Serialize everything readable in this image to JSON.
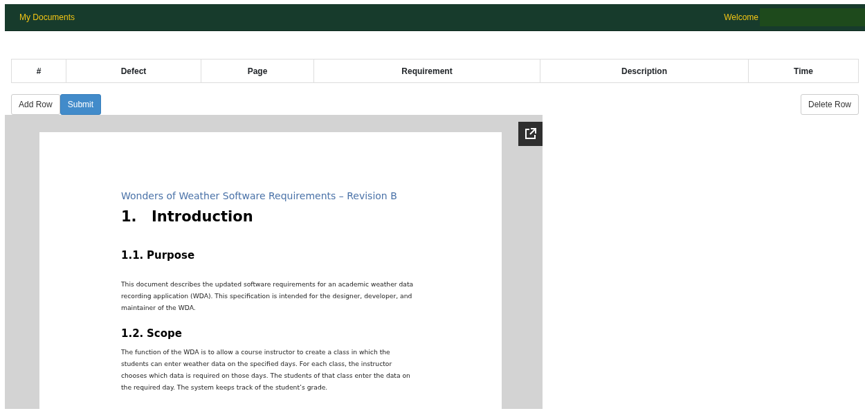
{
  "navbar": {
    "brand": "My Documents",
    "welcome": "Welcome"
  },
  "table": {
    "columns": [
      "#",
      "Defect",
      "Page",
      "Requirement",
      "Description",
      "Time"
    ]
  },
  "buttons": {
    "left": [
      {
        "label": "Add Row",
        "kind": "default"
      },
      {
        "label": "Submit",
        "kind": "primary"
      }
    ],
    "right": [
      {
        "label": "Delete Row"
      }
    ]
  },
  "document": {
    "title": "Wonders of Weather Software Requirements – Revision B",
    "sections": [
      {
        "kind": "h1",
        "number": "1.",
        "text": "Introduction"
      },
      {
        "kind": "h2",
        "number": "1.1.",
        "text": "Purpose"
      },
      {
        "kind": "p",
        "text": "This document describes the updated software requirements for an academic weather data recording application (WDA). This specification is intended for the designer, developer, and maintainer of the WDA."
      },
      {
        "kind": "h2",
        "number": "1.2.",
        "text": "Scope"
      },
      {
        "kind": "p",
        "text": "The function of the WDA is to allow a course instructor to create a class in which the students can enter weather data on the specified days. For each class, the instructor chooses which data is required on those days. The students of that class enter the data on the required day. The system keeps track of the student’s grade."
      }
    ]
  }
}
